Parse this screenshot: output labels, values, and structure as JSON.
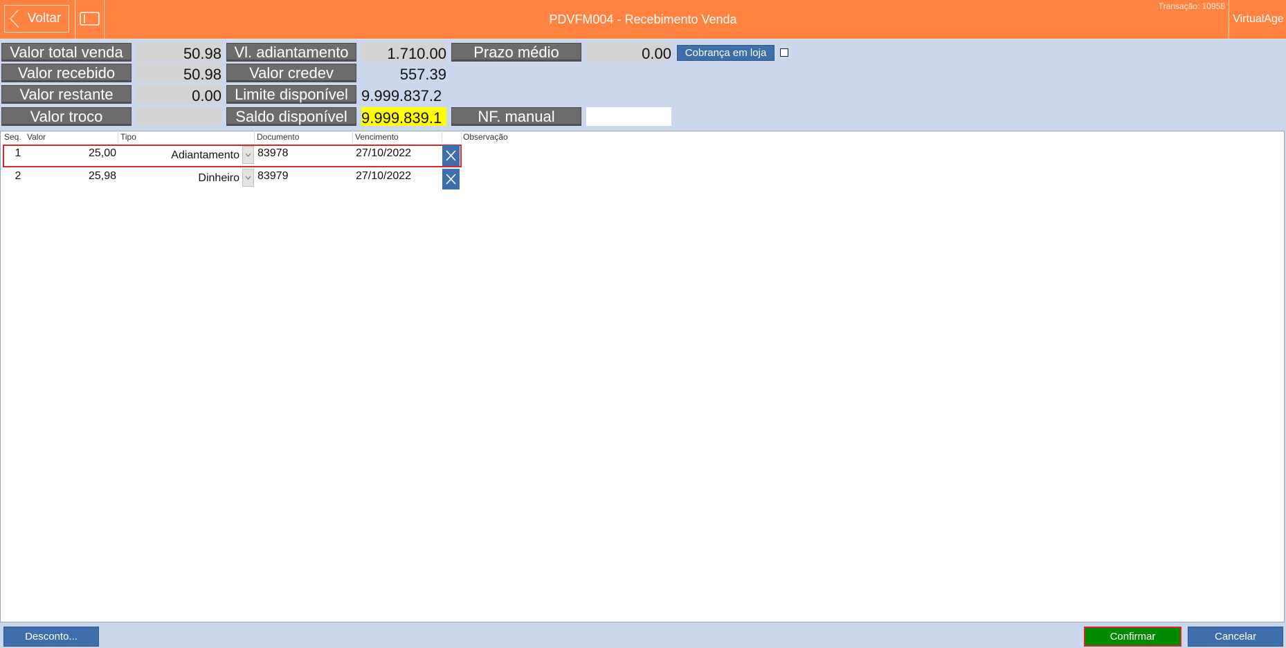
{
  "header": {
    "back_label": "Voltar",
    "title": "PDVFM004 - Recebimento Venda",
    "transacao": "Transação: 10958",
    "brand": "VirtualAge",
    "accent_color": "#ff8240"
  },
  "summary": {
    "valor_total_venda": {
      "label": "Valor total venda",
      "value": "50.98"
    },
    "valor_recebido": {
      "label": "Valor recebido",
      "value": "50.98"
    },
    "valor_restante": {
      "label": "Valor restante",
      "value": "0.00"
    },
    "valor_troco": {
      "label": "Valor troco",
      "value": ""
    },
    "vl_adiantamento": {
      "label": "Vl. adiantamento",
      "value": "1.710.00"
    },
    "valor_credev": {
      "label": "Valor credev",
      "value": "557.39"
    },
    "limite_disponivel": {
      "label": "Limite disponível",
      "value": "9.999.837.2"
    },
    "saldo_disponivel": {
      "label": "Saldo disponível",
      "value": "9.999.839.1"
    },
    "prazo_medio": {
      "label": "Prazo médio",
      "value": "0.00"
    },
    "nf_manual": {
      "label": "NF. manual",
      "value": ""
    },
    "cobranca_label": "Cobrança em loja"
  },
  "table": {
    "columns": [
      "Seq.",
      "Valor",
      "Tipo",
      "Documento",
      "Vencimento",
      "Observação"
    ],
    "rows": [
      {
        "seq": "1",
        "valor": "25,00",
        "tipo": "Adiantamento",
        "documento": "83978",
        "vencimento": "27/10/2022",
        "observacao": ""
      },
      {
        "seq": "2",
        "valor": "25,98",
        "tipo": "Dinheiro",
        "documento": "83979",
        "vencimento": "27/10/2022",
        "observacao": ""
      }
    ]
  },
  "footer": {
    "desconto_label": "Desconto...",
    "confirmar_label": "Confirmar",
    "cancelar_label": "Cancelar"
  }
}
